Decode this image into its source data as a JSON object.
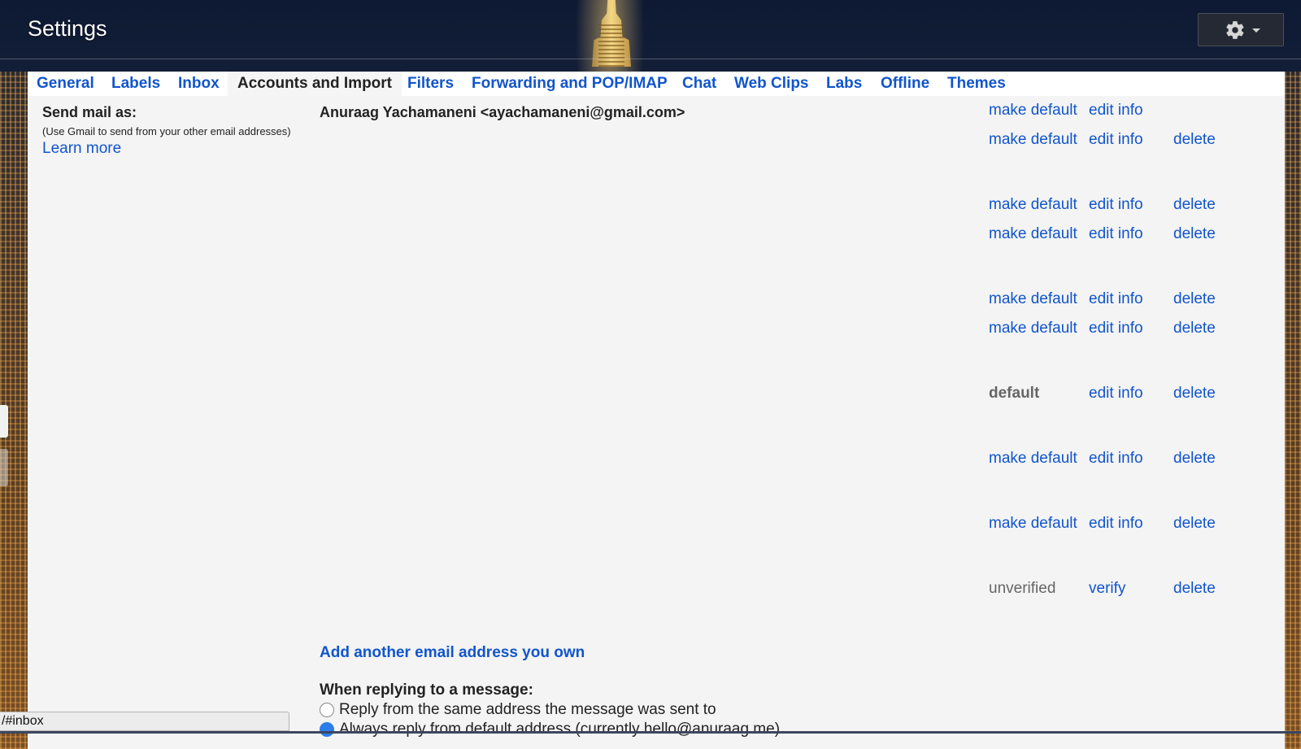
{
  "header": {
    "title": "Settings",
    "settings_icon": "gear-icon"
  },
  "tabs": [
    {
      "label": "General",
      "active": false
    },
    {
      "label": "Labels",
      "active": false
    },
    {
      "label": "Inbox",
      "active": false
    },
    {
      "label": "Accounts and Import",
      "active": true
    },
    {
      "label": "Filters",
      "active": false
    },
    {
      "label": "Forwarding and POP/IMAP",
      "active": false
    },
    {
      "label": "Chat",
      "active": false
    },
    {
      "label": "Web Clips",
      "active": false
    },
    {
      "label": "Labs",
      "active": false
    },
    {
      "label": "Offline",
      "active": false
    },
    {
      "label": "Themes",
      "active": false
    }
  ],
  "send_mail_as": {
    "label": "Send mail as:",
    "help": "(Use Gmail to send from your other email addresses)",
    "learn_more": "Learn more",
    "primary_identity": "Anuraag Yachamaneni <ayachamaneni@gmail.com>",
    "rows": [
      {
        "status": "make default",
        "edit": "edit info",
        "delete": ""
      },
      {
        "status": "make default",
        "edit": "edit info",
        "delete": "delete"
      },
      {
        "status": "make default",
        "edit": "edit info",
        "delete": "delete"
      },
      {
        "status": "make default",
        "edit": "edit info",
        "delete": "delete"
      },
      {
        "status": "make default",
        "edit": "edit info",
        "delete": "delete"
      },
      {
        "status": "make default",
        "edit": "edit info",
        "delete": "delete"
      },
      {
        "status": "default",
        "edit": "edit info",
        "delete": "delete"
      },
      {
        "status": "make default",
        "edit": "edit info",
        "delete": "delete"
      },
      {
        "status": "make default",
        "edit": "edit info",
        "delete": "delete"
      },
      {
        "status": "unverified",
        "edit": "verify",
        "delete": "delete"
      }
    ],
    "add_link": "Add another email address you own"
  },
  "reply": {
    "heading": "When replying to a message:",
    "options": [
      {
        "label": "Reply from the same address the message was sent to",
        "checked": false
      },
      {
        "label": "Always reply from default address (currently hello@anuraag.me)",
        "checked": true
      }
    ]
  },
  "status_bar": {
    "url": "/#inbox"
  },
  "colors": {
    "link": "#1155cc",
    "text": "#222222",
    "muted": "#666666",
    "content_bg": "#f4f4f4"
  }
}
